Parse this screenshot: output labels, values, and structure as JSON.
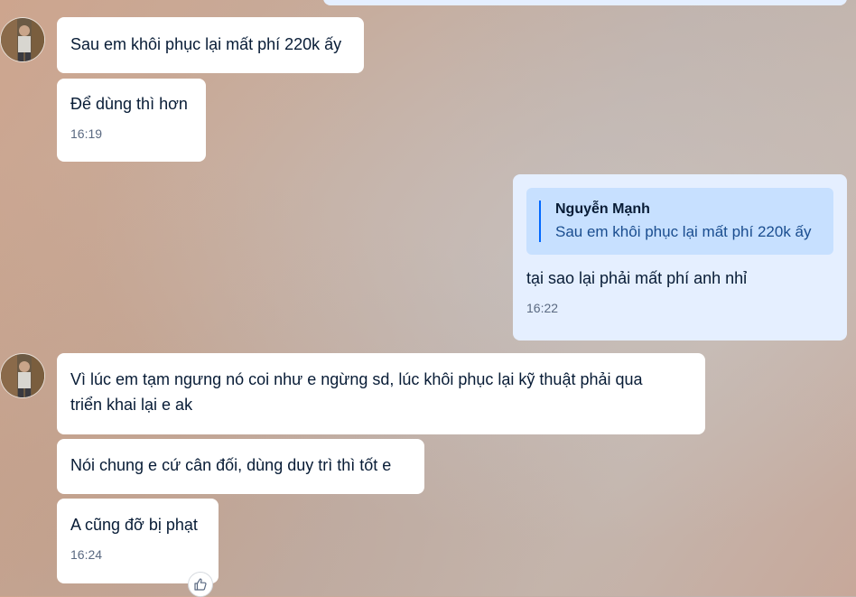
{
  "chat": {
    "messages": [
      {
        "id": 1,
        "sender": "them",
        "text": "Sau em khôi phục lại mất phí 220k ấy"
      },
      {
        "id": 2,
        "sender": "them",
        "text": "Để dùng thì hơn",
        "time": "16:19"
      },
      {
        "id": 3,
        "sender": "me",
        "quote": {
          "name": "Nguyễn Mạnh",
          "text": "Sau em khôi phục lại mất phí 220k ấy"
        },
        "text": "tại sao lại phải mất phí anh nhỉ",
        "time": "16:22"
      },
      {
        "id": 4,
        "sender": "them",
        "text_line1": "Vì lúc em tạm ngưng nó coi như e ngừng sd, lúc khôi phục lại kỹ thuật phải qua",
        "text_line2": "triển khai lại e ak"
      },
      {
        "id": 5,
        "sender": "them",
        "text": "Nói chung e cứ cân đối, dùng duy trì thì tốt e"
      },
      {
        "id": 6,
        "sender": "them",
        "text": "A cũng đỡ bị phạt",
        "time": "16:24"
      }
    ],
    "reaction_icon": "thumbs-up-icon"
  },
  "colors": {
    "their_bubble": "#ffffff",
    "my_bubble": "#e5efff",
    "quote_bg": "#c7e0ff",
    "quote_bar": "#0068ff"
  }
}
